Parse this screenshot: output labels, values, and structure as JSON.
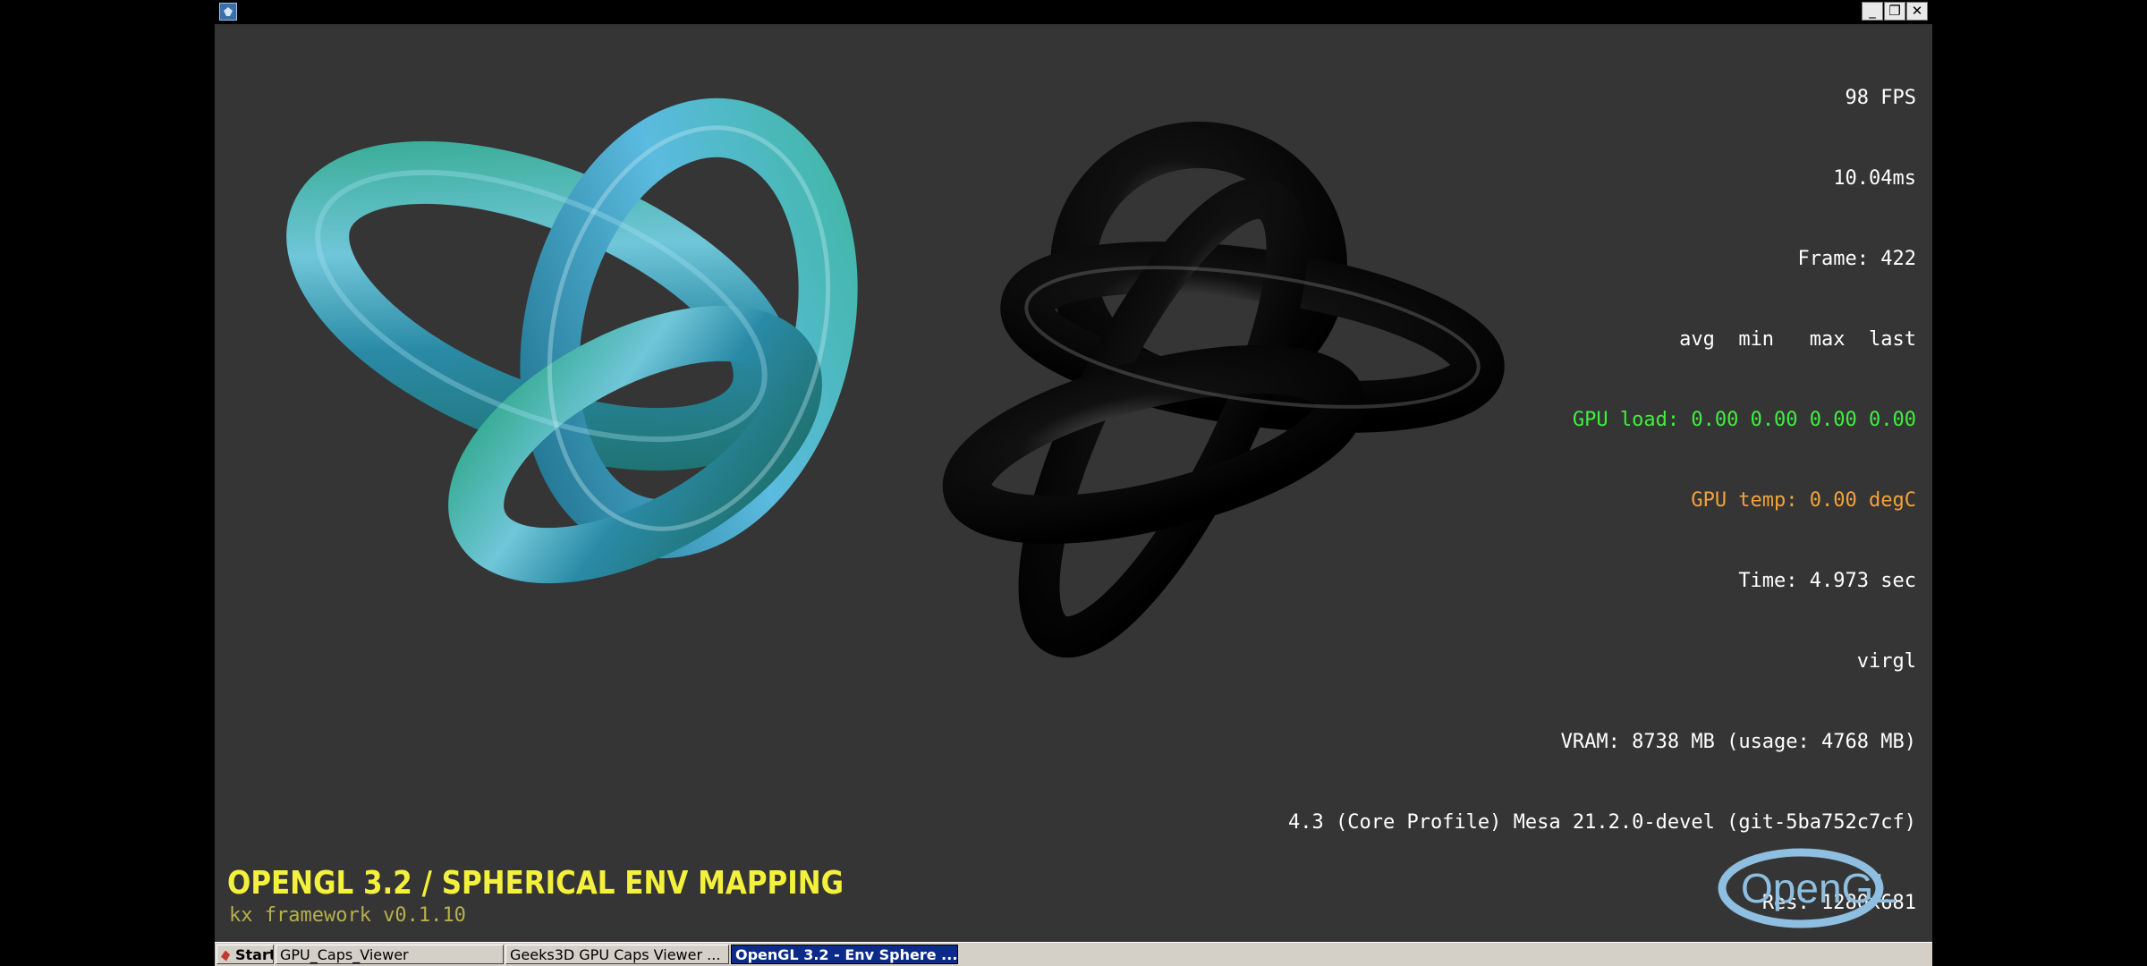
{
  "window": {
    "title_icon": "app-shield-icon",
    "minimize": "_",
    "restore": "❐",
    "close": "✕"
  },
  "overlay": {
    "fps": "98 FPS",
    "frame_time": "10.04ms",
    "frame": "Frame: 422",
    "stats_header": "avg  min   max  last",
    "gpu_load": "GPU load: 0.00 0.00 0.00 0.00",
    "gpu_temp": "GPU temp: 0.00 degC",
    "time": "Time: 4.973 sec",
    "renderer": "virgl",
    "vram": "VRAM: 8738 MB (usage: 4768 MB)",
    "gl_version": "4.3 (Core Profile) Mesa 21.2.0-devel (git-5ba752c7cf)",
    "resolution": "Res: 1280x681",
    "colors": {
      "default": "#ffffff",
      "gpu_load": "#3ff03f",
      "gpu_temp": "#f2a43a"
    }
  },
  "scene": {
    "title": "OPENGL 3.2 / SPHERICAL ENV MAPPING",
    "subtitle": "kx framework v0.1.10",
    "logo_text": "OpenGL",
    "colors": {
      "title": "#f3f13c",
      "subtitle": "#b7b14a",
      "background": "#353535"
    }
  },
  "taskbar": {
    "start": "Start",
    "items": [
      {
        "label": "GPU_Caps_Viewer",
        "active": false
      },
      {
        "label": "Geeks3D GPU Caps Viewer ...",
        "active": false
      },
      {
        "label": "OpenGL 3.2 - Env Sphere ...",
        "active": true
      }
    ]
  }
}
